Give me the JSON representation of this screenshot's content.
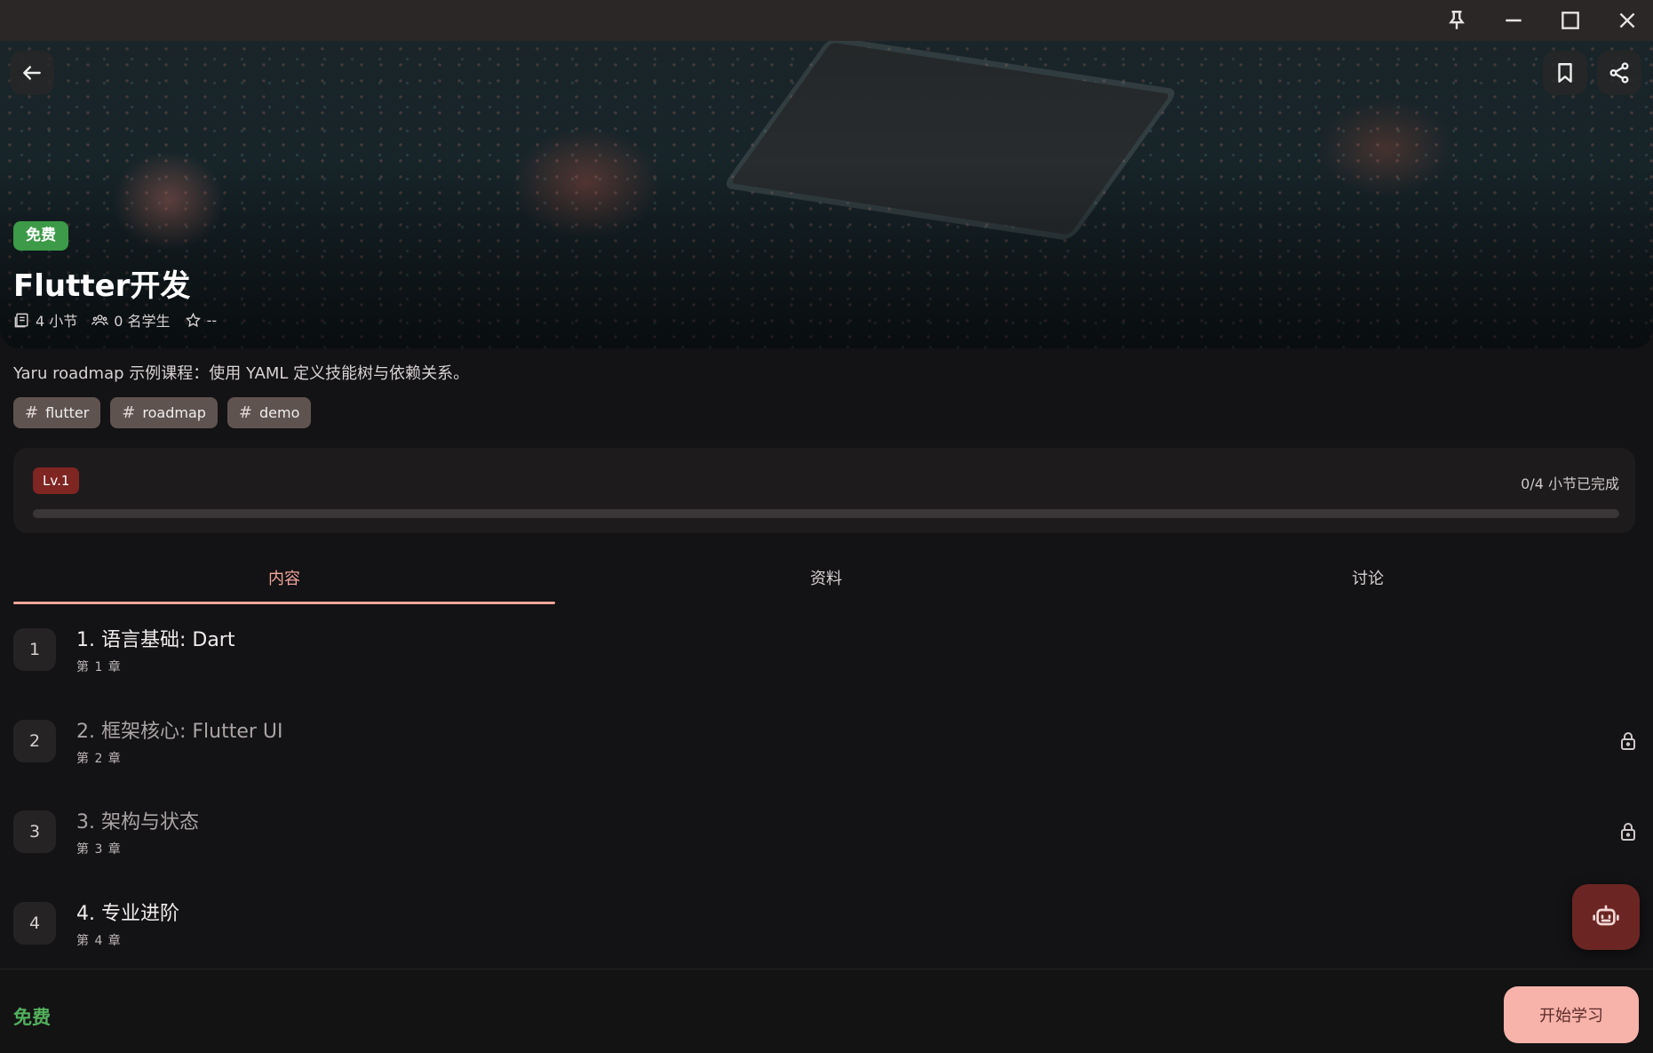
{
  "window": {
    "controls": [
      "pin-icon",
      "minimize-icon",
      "maximize-icon",
      "close-icon"
    ]
  },
  "hero": {
    "badge": "免费",
    "title": "Flutter开发",
    "stats": {
      "lessons": "4 小节",
      "students": "0 名学生",
      "rating": "--"
    }
  },
  "course": {
    "description": "Yaru roadmap 示例课程：使用 YAML 定义技能树与依赖关系。",
    "tags": [
      "flutter",
      "roadmap",
      "demo"
    ]
  },
  "progress": {
    "level": "Lv.1",
    "text": "0/4 小节已完成",
    "fraction": 0
  },
  "tabs": [
    {
      "label": "内容",
      "active": true
    },
    {
      "label": "资料",
      "active": false
    },
    {
      "label": "讨论",
      "active": false
    }
  ],
  "lessons": [
    {
      "num": "1",
      "title": "1. 语言基础: Dart",
      "sub": "第 1 章",
      "locked": false
    },
    {
      "num": "2",
      "title": "2. 框架核心: Flutter UI",
      "sub": "第 2 章",
      "locked": true
    },
    {
      "num": "3",
      "title": "3. 架构与状态",
      "sub": "第 3 章",
      "locked": true
    },
    {
      "num": "4",
      "title": "4. 专业进阶",
      "sub": "第 4 章",
      "locked": false
    }
  ],
  "footer": {
    "price": "免费",
    "start_label": "开始学习"
  },
  "colors": {
    "accent": "#f1a59a",
    "free_green": "#3c9a48",
    "level_red": "#7f2522",
    "fab": "#6b2623"
  }
}
